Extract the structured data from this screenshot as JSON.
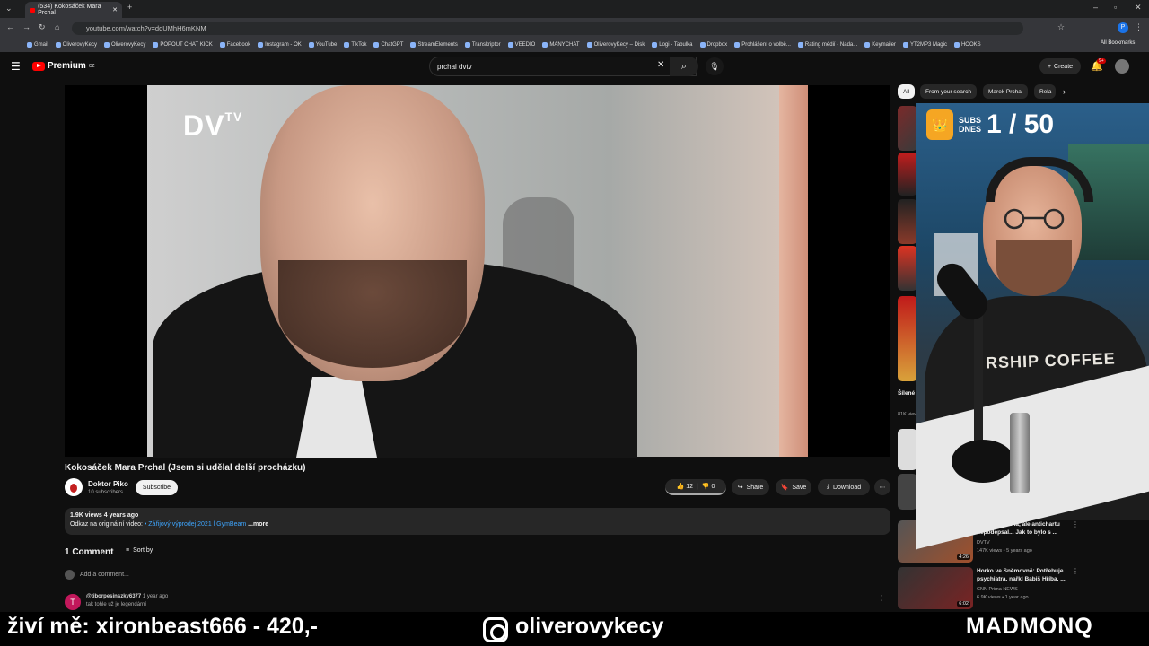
{
  "browser": {
    "tab_title": "(534) Kokosáček Mara Prchal",
    "url": "youtube.com/watch?v=ddUMhH6mKNM",
    "bookmarks": [
      "Gmail",
      "OliverovyKecy",
      "OliverovyKecy",
      "POPOUT CHAT KICK",
      "Facebook",
      "Instagram - OK",
      "YouTube",
      "TikTok",
      "ChatGPT",
      "StreamElements",
      "Transkriptor",
      "VEEDIO",
      "MANYCHAT",
      "OliverovyKecy – Disk",
      "Logi - Tabulka",
      "Dropbox",
      "Prohlášení o volbě...",
      "Rating médií - Nada...",
      "Keymailer",
      "YT2MP3 Magic",
      "HOOKS"
    ],
    "all_bookmarks": "All Bookmarks"
  },
  "youtube": {
    "logo_text": "Premium",
    "logo_sup": "CZ",
    "search_value": "prchal dvtv",
    "create_label": "Create",
    "notif_count": "9+"
  },
  "video": {
    "watermark": "DV",
    "watermark_sup": "TV",
    "title": "Kokosáček Mara Prchal (Jsem si udělal delší procházku)",
    "channel_name": "Doktor Piko",
    "channel_subs": "10 subscribers",
    "subscribe_label": "Subscribe",
    "likes": "12",
    "dislikes": "0",
    "share_label": "Share",
    "save_label": "Save",
    "download_label": "Download",
    "views_line": "1.9K views  4 years ago",
    "desc_prefix": "Odkaz na originální video:",
    "desc_link": "• Zářijový výprodej 2021 l GymBeam",
    "desc_more": "...more"
  },
  "comments": {
    "count_label": "1 Comment",
    "sort_label": "Sort by",
    "add_placeholder": "Add a comment...",
    "first_author": "@tiborpesinszky6377",
    "first_time": "1 year ago",
    "first_text": "tak tohle už je legendární",
    "first_initial": "T"
  },
  "sidebar": {
    "chips": [
      "All",
      "From your search",
      "Marek Prchal",
      "Rela"
    ],
    "items": [
      {
        "title": "Šílené historie...",
        "meta": "81K views"
      },
      {
        "title": "V ruce pero má, ale antichartu nepodepsal... Jak to bylo s ...",
        "channel": "DVTV",
        "meta": "147K views • 5 years ago",
        "duration": "4:26"
      },
      {
        "title": "Horko ve Sněmovně: Potřebuje psychiatra, nařkl Babiš Hříba. ...",
        "channel": "CNN Prima NEWS",
        "meta": "6.9K views • 1 year ago",
        "duration": "6:02"
      }
    ]
  },
  "overlay": {
    "subs_label_1": "SUBS",
    "subs_label_2": "DNES",
    "subs_count": "1 / 50",
    "shirt_text": "RSHIP COFFEE",
    "footer_left": "živí mě: xironbeast666 - 420,-",
    "footer_instagram": "oliverovykecy",
    "footer_right": "MADMONQ"
  },
  "colors": {
    "accent": "#ff0000",
    "bg": "#0f0f0f",
    "chip": "#272727"
  }
}
